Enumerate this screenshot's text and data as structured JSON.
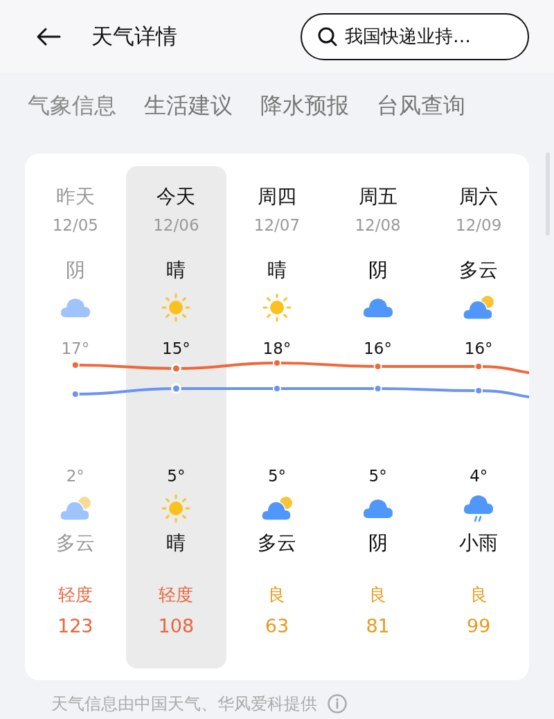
{
  "header": {
    "title": "天气详情",
    "search": {
      "value": "我国快递业持…"
    }
  },
  "tabs": [
    {
      "label": "气象信息"
    },
    {
      "label": "生活建议"
    },
    {
      "label": "降水预报"
    },
    {
      "label": "台风查询"
    }
  ],
  "days": [
    {
      "day": "昨天",
      "date": "12/05",
      "past": true,
      "selected": false,
      "day_weather": {
        "text": "阴",
        "kind": "cloudy"
      },
      "high": "17°",
      "low": "2°",
      "night_weather": {
        "text": "多云",
        "kind": "partly_cloudy"
      },
      "aqi": {
        "label": "轻度",
        "value": "123",
        "color": "#e8653c"
      }
    },
    {
      "day": "今天",
      "date": "12/06",
      "past": false,
      "selected": true,
      "day_weather": {
        "text": "晴",
        "kind": "sunny"
      },
      "high": "15°",
      "low": "5°",
      "night_weather": {
        "text": "晴",
        "kind": "sunny"
      },
      "aqi": {
        "label": "轻度",
        "value": "108",
        "color": "#e8653c"
      }
    },
    {
      "day": "周四",
      "date": "12/07",
      "past": false,
      "selected": false,
      "day_weather": {
        "text": "晴",
        "kind": "sunny"
      },
      "high": "18°",
      "low": "5°",
      "night_weather": {
        "text": "多云",
        "kind": "partly_cloudy"
      },
      "aqi": {
        "label": "良",
        "value": "63",
        "color": "#e89a1c"
      }
    },
    {
      "day": "周五",
      "date": "12/08",
      "past": false,
      "selected": false,
      "day_weather": {
        "text": "阴",
        "kind": "cloudy"
      },
      "high": "16°",
      "low": "5°",
      "night_weather": {
        "text": "阴",
        "kind": "cloudy"
      },
      "aqi": {
        "label": "良",
        "value": "81",
        "color": "#e89a1c"
      }
    },
    {
      "day": "周六",
      "date": "12/09",
      "past": false,
      "selected": false,
      "day_weather": {
        "text": "多云",
        "kind": "partly_cloudy"
      },
      "high": "16°",
      "low": "4°",
      "night_weather": {
        "text": "小雨",
        "kind": "rain"
      },
      "aqi": {
        "label": "良",
        "value": "99",
        "color": "#e89a1c"
      }
    }
  ],
  "footer": {
    "text": "天气信息由中国天气、华风爱科提供"
  }
}
